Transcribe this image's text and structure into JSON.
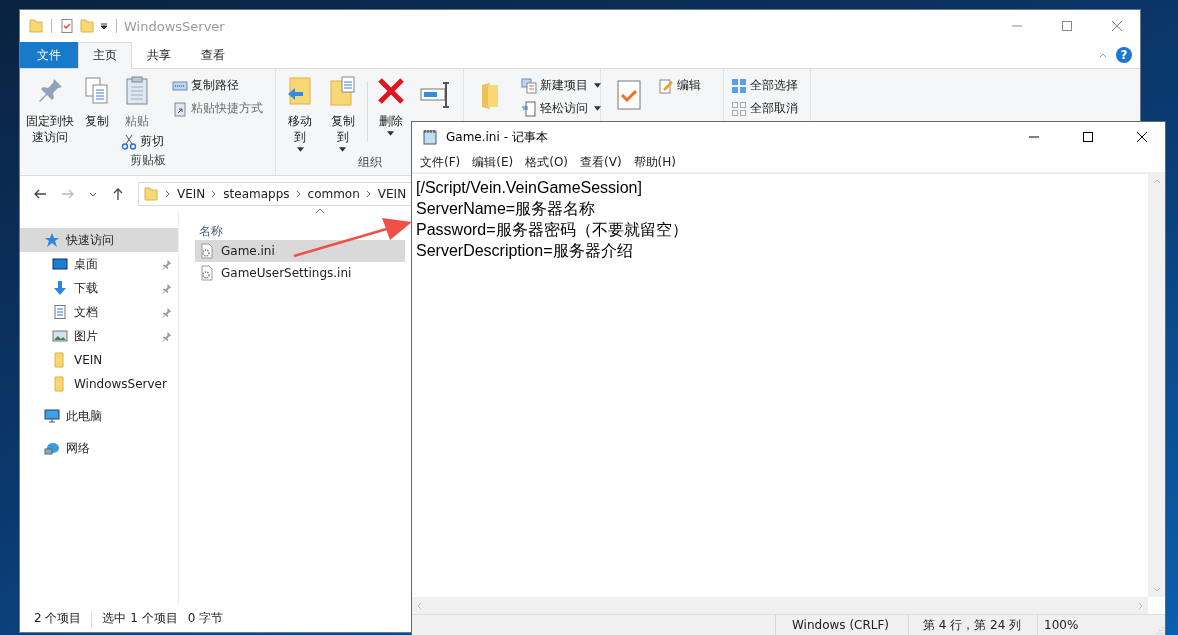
{
  "explorer": {
    "title": "WindowsServer",
    "ribbon_tabs": [
      {
        "label": "文件",
        "kind": "file",
        "selected": false
      },
      {
        "label": "主页",
        "kind": "tab",
        "selected": true
      },
      {
        "label": "共享",
        "kind": "tab",
        "selected": false
      },
      {
        "label": "查看",
        "kind": "tab",
        "selected": false
      }
    ],
    "help": "?",
    "clipboard": {
      "label": "剪贴板",
      "pin": "固定到快速访问",
      "copy": "复制",
      "paste": "粘贴",
      "cut": "剪切",
      "copy_path": "复制路径",
      "paste_shortcut": "粘贴快捷方式"
    },
    "organize": {
      "label": "组织",
      "move_to": "移动到",
      "copy_to": "复制到",
      "delete": "删除"
    },
    "new": {
      "new_item": "新建项目",
      "easy_access": "轻松访问"
    },
    "open": {
      "edit": "编辑"
    },
    "select": {
      "select_all": "全部选择",
      "select_none": "全部取消"
    },
    "breadcrumbs": [
      "VEIN",
      "steamapps",
      "common",
      "VEIN"
    ],
    "nav": [
      {
        "label": "快速访问",
        "selected": true,
        "children": [
          {
            "label": "桌面",
            "selected": false,
            "pinned": true
          },
          {
            "label": "下载",
            "selected": false,
            "pinned": true
          },
          {
            "label": "文档",
            "selected": false,
            "pinned": true
          },
          {
            "label": "图片",
            "selected": false,
            "pinned": true
          },
          {
            "label": "VEIN",
            "selected": false,
            "pinned": false
          },
          {
            "label": "WindowsServer",
            "selected": false,
            "pinned": false
          }
        ]
      },
      {
        "label": "此电脑",
        "selected": false
      },
      {
        "label": "网络",
        "selected": false
      }
    ],
    "column": "名称",
    "files": [
      {
        "name": "Game.ini",
        "selected": true
      },
      {
        "name": "GameUserSettings.ini",
        "selected": false
      }
    ],
    "status": [
      "2 个项目",
      "选中 1 个项目",
      "0 字节"
    ]
  },
  "notepad": {
    "title": "Game.ini - 记事本",
    "menu": [
      "文件(F)",
      "编辑(E)",
      "格式(O)",
      "查看(V)",
      "帮助(H)"
    ],
    "lines": [
      "[/Script/Vein.VeinGameSession]",
      "ServerName=服务器名称",
      "Password=服务器密码（不要就留空）",
      "ServerDescription=服务器介绍"
    ],
    "status": [
      "Windows (CRLF)",
      "第 4 行，第 24 列",
      "100%"
    ]
  }
}
